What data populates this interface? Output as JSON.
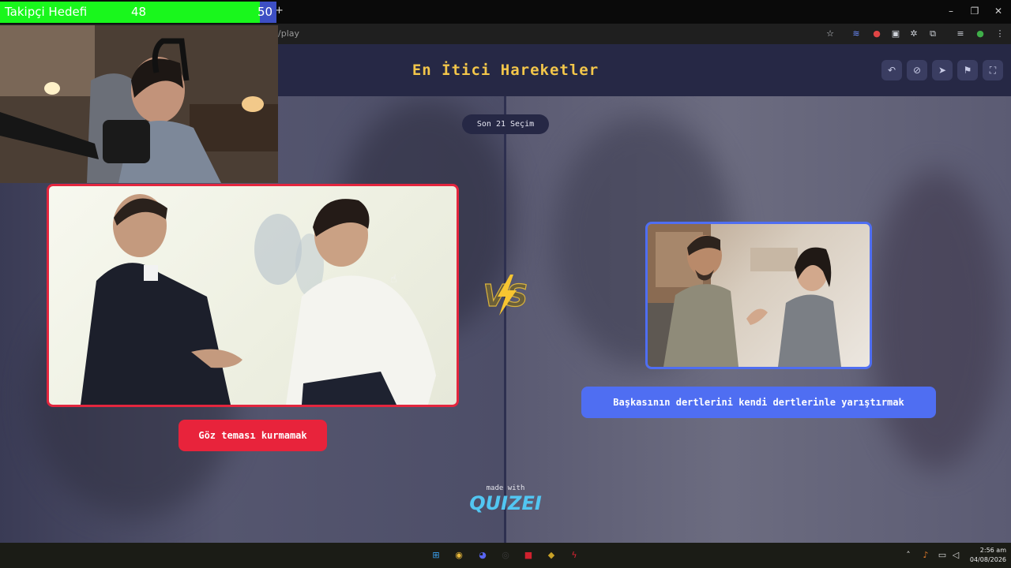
{
  "browser": {
    "url": "/play",
    "tab_plus": "+",
    "window_controls": {
      "minimize": "–",
      "restore": "❐",
      "close": "✕"
    },
    "extensions": [
      {
        "name": "bookmark-star-icon",
        "glyph": "☆"
      },
      {
        "name": "wave-extension-icon",
        "glyph": "≋"
      },
      {
        "name": "red-extension-icon",
        "glyph": "●"
      },
      {
        "name": "window-extension-icon",
        "glyph": "▣"
      },
      {
        "name": "gear-extension-icon",
        "glyph": "✲"
      },
      {
        "name": "puzzle-icon",
        "glyph": "⧉"
      },
      {
        "name": "queue-icon",
        "glyph": "≡"
      },
      {
        "name": "profile-avatar",
        "glyph": "●"
      },
      {
        "name": "kebab-menu-icon",
        "glyph": "⋮"
      }
    ]
  },
  "stream_overlay": {
    "follower_goal_label": "Takipçi Hedefi",
    "follower_current": "48",
    "follower_goal": "50",
    "progress_fraction": 0.96,
    "fill_color": "#19f71c",
    "bar_color": "#3d4fc4"
  },
  "page": {
    "title": "En İtici Hareketler",
    "round_label": "Son 21 Seçim",
    "header_buttons": [
      {
        "name": "undo-icon",
        "glyph": "↶"
      },
      {
        "name": "link-icon",
        "glyph": "⊘"
      },
      {
        "name": "share-icon",
        "glyph": "➤"
      },
      {
        "name": "flag-icon",
        "glyph": "⚑"
      },
      {
        "name": "fullscreen-icon",
        "glyph": "⛶"
      }
    ],
    "left_option": {
      "label": "Göz teması kurmamak",
      "accent": "#e3263e"
    },
    "right_option": {
      "label": "Başkasının dertlerini kendi dertlerinle yarıştırmak",
      "accent": "#4f6ef2"
    },
    "vs_text": "VS",
    "made_with": "made with",
    "brand": "QUIZEI"
  },
  "taskbar": {
    "apps": [
      {
        "name": "windows-start-icon",
        "glyph": "⊞",
        "color": "#3aa0f0"
      },
      {
        "name": "chrome-icon",
        "glyph": "◉",
        "color": "#e9b83a"
      },
      {
        "name": "discord-icon",
        "glyph": "◕",
        "color": "#5865f2"
      },
      {
        "name": "obs-icon",
        "glyph": "◎",
        "color": "#3a3a3a"
      },
      {
        "name": "red-app-icon",
        "glyph": "■",
        "color": "#d0212e"
      },
      {
        "name": "wizard-app-icon",
        "glyph": "◆",
        "color": "#c9a227"
      },
      {
        "name": "lightning-app-icon",
        "glyph": "ϟ",
        "color": "#e02433"
      }
    ],
    "tray": [
      {
        "name": "chevron-up-icon",
        "glyph": "˄"
      },
      {
        "name": "microphone-icon",
        "glyph": "♪"
      },
      {
        "name": "network-icon",
        "glyph": "▭"
      },
      {
        "name": "volume-icon",
        "glyph": "◁"
      }
    ],
    "time": "2:56 am",
    "date": "04/08/2026"
  }
}
